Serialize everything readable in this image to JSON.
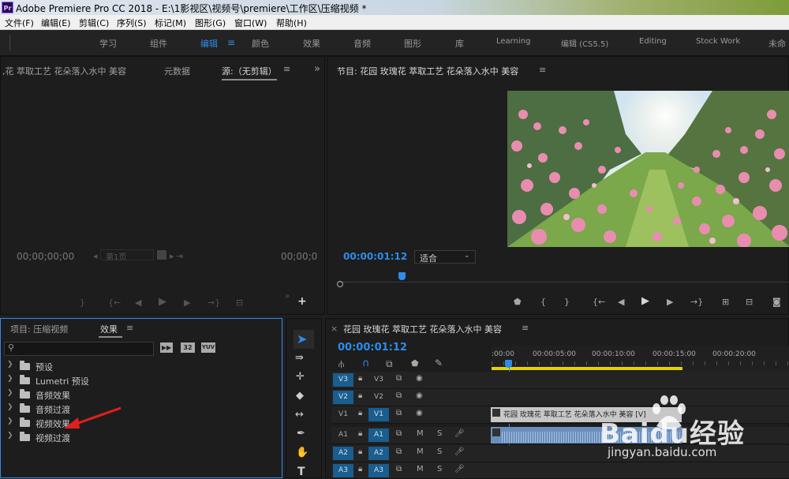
{
  "titlebar": {
    "app_icon": "Pr",
    "title": "Adobe Premiere Pro CC 2018 - E:\\1影视区\\视频号\\premiere\\工作区\\压缩视频 *"
  },
  "menu": [
    "文件(F)",
    "编辑(E)",
    "剪辑(C)",
    "序列(S)",
    "标记(M)",
    "图形(G)",
    "窗口(W)",
    "帮助(H)"
  ],
  "workspaces": [
    "学习",
    "组件",
    "编辑",
    "颜色",
    "效果",
    "音频",
    "图形",
    "库",
    "Learning",
    "编辑 (CS5.5)",
    "Editing",
    "Stock Work",
    "未命"
  ],
  "active_workspace": "编辑",
  "source_panel": {
    "tab1": ",花 萃取工艺 花朵落入水中 美容",
    "tab2": "元数据",
    "tab3": "源:（无剪辑）",
    "overflow": "»",
    "timecode_left": "00;00;00;00",
    "page_label": "第1页",
    "timecode_right": "00;00;0"
  },
  "program_panel": {
    "title": "节目: 花园 玫瑰花 萃取工艺 花朵落入水中 美容",
    "timecode": "00:00:01:12",
    "fit_label": "适合",
    "playhead_fraction": 0.14
  },
  "project_panel": {
    "tab_project": "项目: 压缩视频",
    "tab_effects": "效果",
    "search_placeholder": "",
    "badges": [
      "32",
      "YUV"
    ],
    "tree": [
      "预设",
      "Lumetri 预设",
      "音频效果",
      "音频过渡",
      "视频效果",
      "视频过渡"
    ]
  },
  "timeline": {
    "sequence_name": "花园 玫瑰花 萃取工艺 花朵落入水中 美容",
    "timecode": "00:00:01:12",
    "ruler": [
      ":00:00",
      "00:00:05:00",
      "00:00:10:00",
      "00:00:15:00",
      "00:00:20:00"
    ],
    "tracks": [
      {
        "id": "V3",
        "target": "V3",
        "kind": "video"
      },
      {
        "id": "V2",
        "target": "V2",
        "kind": "video"
      },
      {
        "id": "V1",
        "target": "V1",
        "kind": "video"
      },
      {
        "id": "A1",
        "target": "A1",
        "kind": "audio"
      },
      {
        "id": "A2",
        "target": "A2",
        "kind": "audio"
      },
      {
        "id": "A3",
        "target": "A3",
        "kind": "audio"
      }
    ],
    "clip_label": "花园 玫瑰花 萃取工艺 花朵落入水中 美容 [V]",
    "mute_label": "M",
    "solo_label": "S"
  },
  "watermark": {
    "text": "Baidu经验",
    "url": "jingyan.baidu.com"
  },
  "colors": {
    "accent": "#2d8ceb",
    "track_blue": "#1a5d8f",
    "clip_video": "#c7c7c7",
    "clip_audio": "#6b8fbd",
    "work_area": "#e6d200"
  }
}
